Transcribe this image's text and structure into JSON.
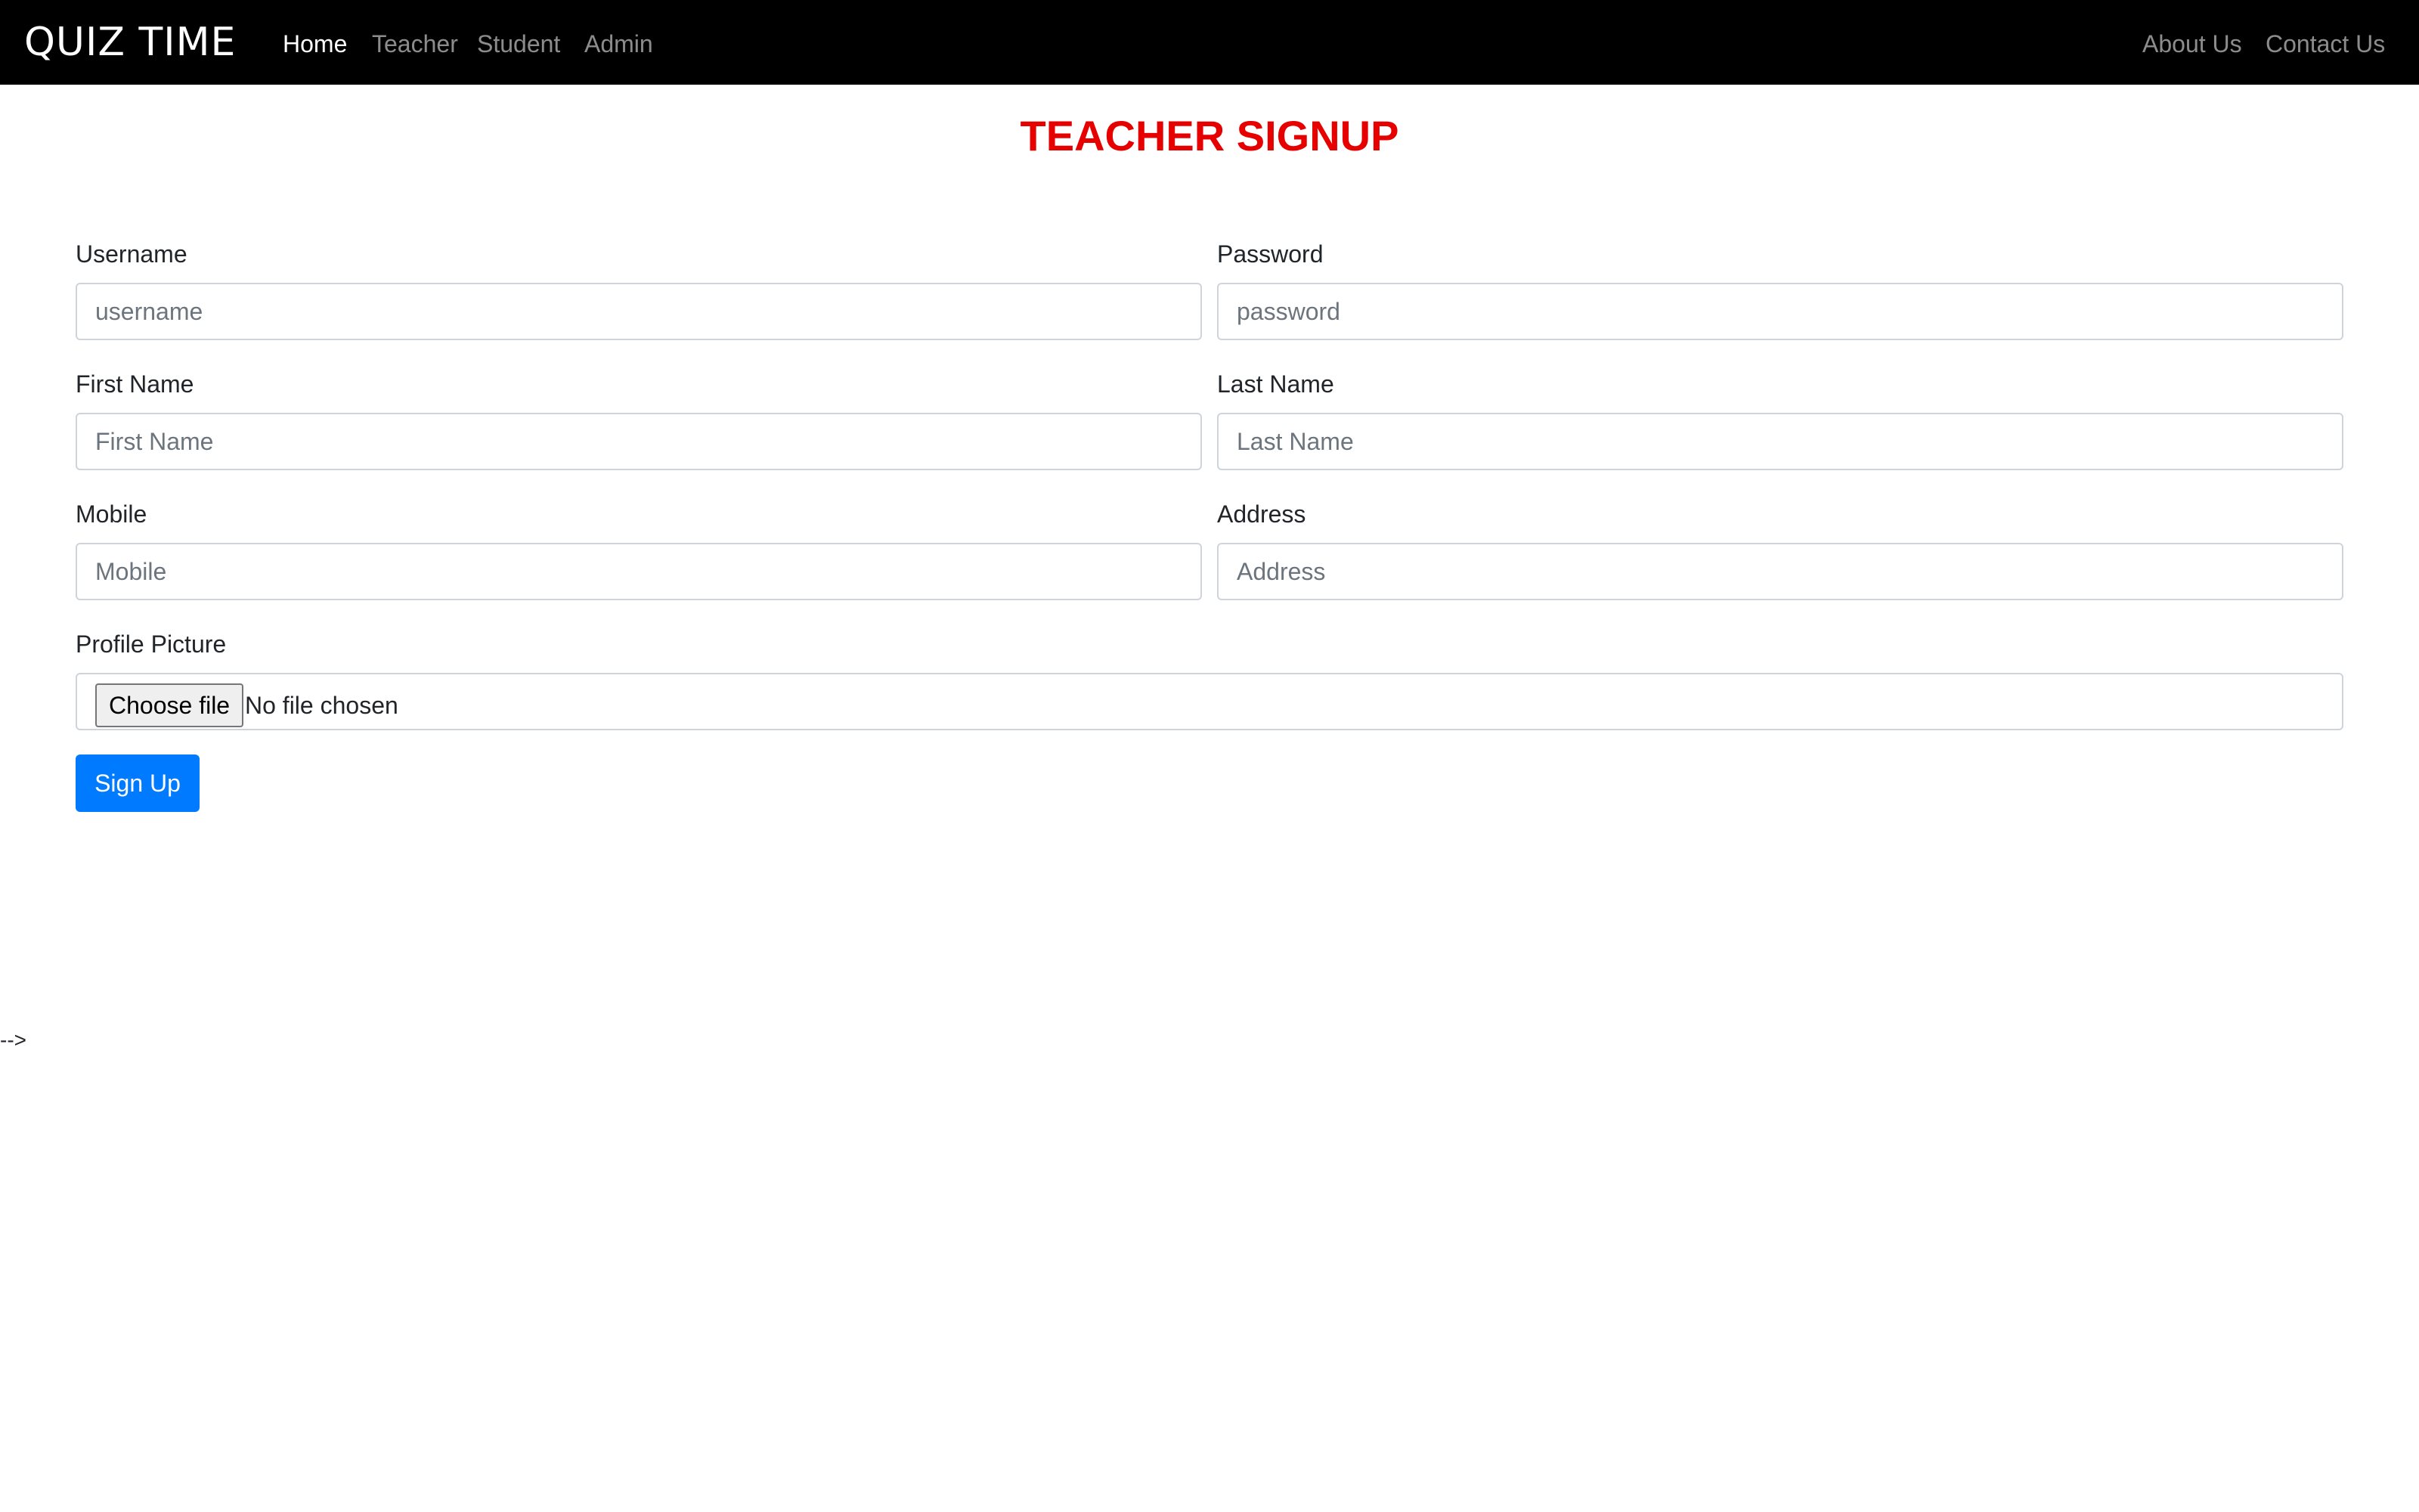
{
  "navbar": {
    "brand": "QUIZ TIME",
    "links": [
      {
        "label": "Home"
      },
      {
        "label": "Teacher"
      },
      {
        "label": "Student"
      },
      {
        "label": "Admin"
      }
    ],
    "right_links": [
      {
        "label": "About Us"
      },
      {
        "label": "Contact Us"
      }
    ]
  },
  "page": {
    "title": "TEACHER SIGNUP",
    "title_color": "#e60000"
  },
  "form": {
    "username": {
      "label": "Username",
      "placeholder": "username"
    },
    "password": {
      "label": "Password",
      "placeholder": "password"
    },
    "first_name": {
      "label": "First Name",
      "placeholder": "First Name"
    },
    "last_name": {
      "label": "Last Name",
      "placeholder": "Last Name"
    },
    "mobile": {
      "label": "Mobile",
      "placeholder": "Mobile"
    },
    "address": {
      "label": "Address",
      "placeholder": "Address"
    },
    "profile_picture": {
      "label": "Profile Picture",
      "button_label": "Choose file",
      "status": "No file chosen"
    },
    "submit_label": "Sign Up",
    "submit_color": "#007bff"
  },
  "stray_text": "-->"
}
